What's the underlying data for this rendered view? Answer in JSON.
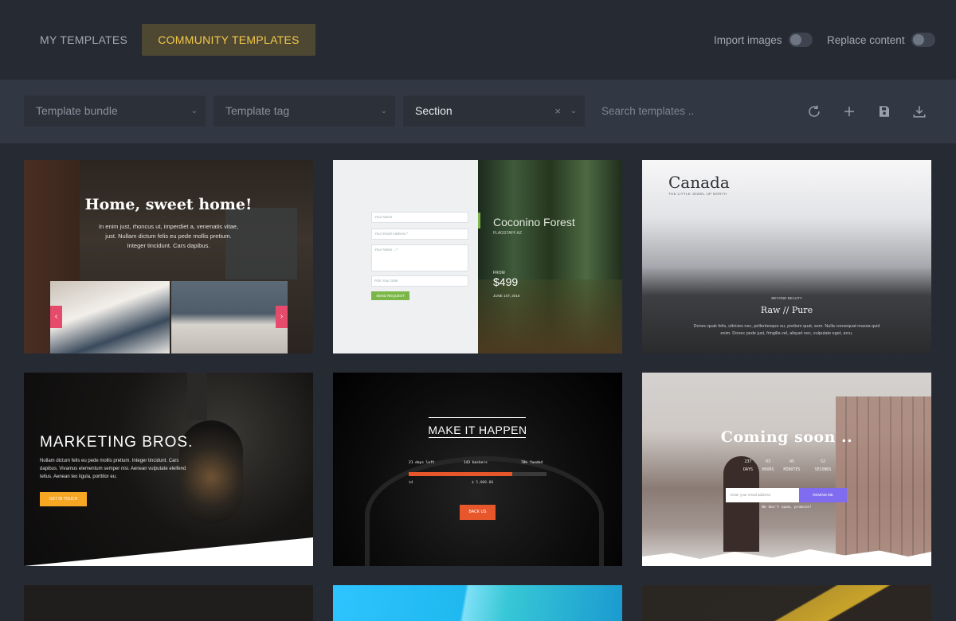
{
  "tabs": {
    "my_templates": "MY TEMPLATES",
    "community_templates": "COMMUNITY TEMPLATES"
  },
  "toggles": {
    "import_images": "Import images",
    "replace_content": "Replace content"
  },
  "filters": {
    "bundle_placeholder": "Template bundle",
    "tag_placeholder": "Template tag",
    "section_value": "Section",
    "search_placeholder": "Search templates .."
  },
  "toolbar_icons": [
    "refresh-icon",
    "plus-icon",
    "save-icon",
    "download-icon"
  ],
  "colors": {
    "accent": "#f3c84a",
    "background": "#262a33",
    "filterbar": "#323843"
  },
  "templates": [
    {
      "title": "Home, sweet home!",
      "text": "In enim just, rhoncus ut, imperdiet a, venenatis vitae, just. Nullam dictum felis eu pede mollis pretium. Integer tincidunt. Cars dapibus."
    },
    {
      "title": "Coconino Forest",
      "subtitle": "FLAGSTAFF AZ",
      "from": "FROM",
      "price": "$499",
      "date": "JUNE 1ST, 2016",
      "fields": [
        "Your Name",
        "Your Email Address *",
        "Your Notes ...*",
        "Pick Your Date"
      ],
      "button": "SEND REQUEST"
    },
    {
      "logo": "Canada",
      "tagline": "THE LITTLE JEWEL UP NORTH",
      "kicker": "BEYOND BEAUTY",
      "title": "Raw // Pure",
      "text": "Donec quak felis, ultricies nec, pellentesque eu, pretium quat, sem. Nulla consequat massa quid enim. Donec pede just, fringilla vel, aliquet nec, vulputate eget, arcu."
    },
    {
      "title": "MARKETING BROS.",
      "text": "Nullam dictum felis eu pede mollis pretium. Integer tincidunt. Cars dapibus. Vivamus elementum semper nisi. Aenean vulputate eleifend tellus. Aenean leo ligula, porttitor eu.",
      "button": "GET IN TOUCH"
    },
    {
      "title": "MAKE IT HAPPEN",
      "stat_days": "21 days left",
      "stat_backers": "143 backers",
      "stat_funded": "78% funded",
      "amount_a": "$4",
      "amount_b": "$ 5,000.00",
      "progress": 0.75,
      "button": "BACK US"
    },
    {
      "title": "Coming soon ..",
      "countdown": [
        {
          "value": "237",
          "label": "DAYS"
        },
        {
          "value": "03",
          "label": "HOURS"
        },
        {
          "value": "45",
          "label": "MINUTES"
        },
        {
          "value": "52",
          "label": "SECONDS"
        }
      ],
      "email_placeholder": "Enter your email address",
      "button": "REMIND ME",
      "note": "We don't spam, promise!"
    }
  ]
}
